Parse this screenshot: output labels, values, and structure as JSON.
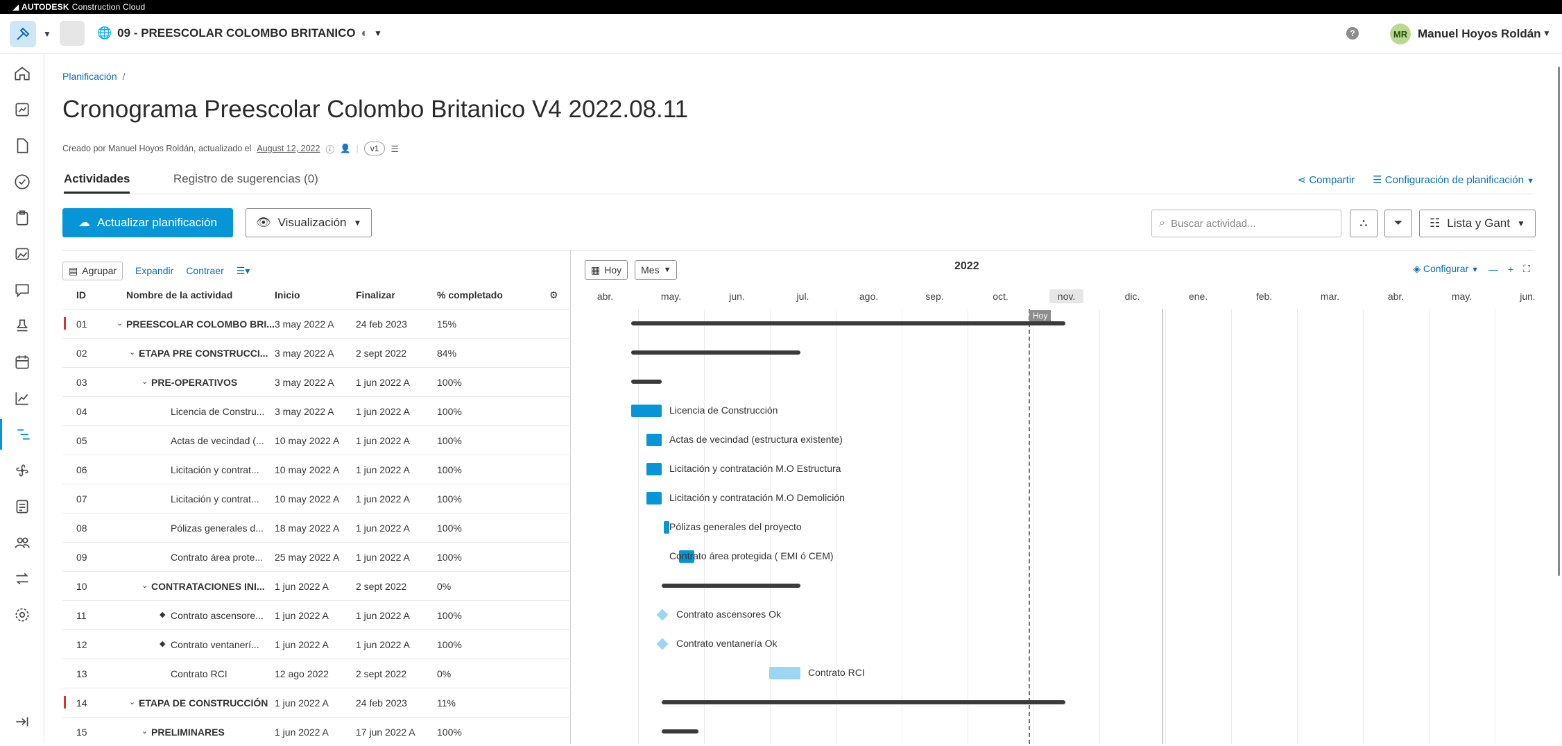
{
  "app": {
    "brand": "AUTODESK",
    "brand_sub": "Construction Cloud",
    "project": "09 - PREESCOLAR COLOMBO BRITANICO",
    "user_initials": "MR",
    "user_name": "Manuel Hoyos Roldán"
  },
  "sidebar": {
    "items": [
      "home-icon",
      "dashboard-icon",
      "document-icon",
      "checklist-icon",
      "clipboard-icon",
      "photo-icon",
      "chat-icon",
      "stamp-icon",
      "calendar-icon",
      "chart-icon",
      "schedule-icon",
      "fan-icon",
      "forms-icon",
      "people-icon",
      "transfer-icon",
      "gear-icon",
      "collapse-icon"
    ],
    "active": "schedule-icon"
  },
  "page": {
    "breadcrumb": "Planificación",
    "title": "Cronograma Preescolar Colombo Britanico V4 2022.08.11",
    "meta_prefix": "Creado por Manuel Hoyos Roldán, actualizado el",
    "meta_date": "August 12, 2022",
    "version": "v1"
  },
  "tabs": {
    "activities": "Actividades",
    "suggestions": "Registro de sugerencias (0)",
    "share": "Compartir",
    "config": "Configuración de planificación"
  },
  "toolbar": {
    "update": "Actualizar planificación",
    "view": "Visualización",
    "search_placeholder": "Buscar actividad...",
    "list_gantt": "Lista y Gant"
  },
  "list": {
    "group": "Agrupar",
    "expand": "Expandir",
    "collapse": "Contraer",
    "headers": {
      "id": "ID",
      "name": "Nombre de la actividad",
      "start": "Inicio",
      "finish": "Finalizar",
      "pct": "% completado"
    },
    "rows": [
      {
        "id": "01",
        "name": "PREESCOLAR COLOMBO BRI...",
        "start": "3 may 2022 A",
        "finish": "24 feb 2023",
        "pct": "15%"
      },
      {
        "id": "02",
        "name": "ETAPA PRE CONSTRUCCI...",
        "start": "3 may 2022 A",
        "finish": "2 sept 2022",
        "pct": "84%"
      },
      {
        "id": "03",
        "name": "PRE-OPERATIVOS",
        "start": "3 may 2022 A",
        "finish": "1 jun 2022 A",
        "pct": "100%"
      },
      {
        "id": "04",
        "name": "Licencia de Constru...",
        "start": "3 may 2022 A",
        "finish": "1 jun 2022 A",
        "pct": "100%"
      },
      {
        "id": "05",
        "name": "Actas de vecindad (...",
        "start": "10 may 2022 A",
        "finish": "1 jun 2022 A",
        "pct": "100%"
      },
      {
        "id": "06",
        "name": "Licitación y contrat...",
        "start": "10 may 2022 A",
        "finish": "1 jun 2022 A",
        "pct": "100%"
      },
      {
        "id": "07",
        "name": "Licitación y contrat...",
        "start": "10 may 2022 A",
        "finish": "1 jun 2022 A",
        "pct": "100%"
      },
      {
        "id": "08",
        "name": "Pólizas generales d...",
        "start": "18 may 2022 A",
        "finish": "1 jun 2022 A",
        "pct": "100%"
      },
      {
        "id": "09",
        "name": "Contrato área prote...",
        "start": "25 may 2022 A",
        "finish": "1 jun 2022 A",
        "pct": "100%"
      },
      {
        "id": "10",
        "name": "CONTRATACIONES INI...",
        "start": "1 jun 2022 A",
        "finish": "2 sept 2022",
        "pct": "0%"
      },
      {
        "id": "11",
        "name": "Contrato ascensore...",
        "start": "1 jun 2022 A",
        "finish": "1 jun 2022 A",
        "pct": "100%"
      },
      {
        "id": "12",
        "name": "Contrato ventanerí...",
        "start": "1 jun 2022 A",
        "finish": "1 jun 2022 A",
        "pct": "100%"
      },
      {
        "id": "13",
        "name": "Contrato RCI",
        "start": "12 ago 2022",
        "finish": "2 sept 2022",
        "pct": "0%"
      },
      {
        "id": "14",
        "name": "ETAPA DE CONSTRUCCIÓN",
        "start": "1 jun 2022 A",
        "finish": "24 feb 2023",
        "pct": "11%"
      },
      {
        "id": "15",
        "name": "PRELIMINARES",
        "start": "1 jun 2022 A",
        "finish": "17 jun 2022 A",
        "pct": "100%"
      }
    ]
  },
  "gantt": {
    "today": "Hoy",
    "scale": "Mes",
    "year": "2022",
    "configure": "Configurar",
    "months": [
      "abr.",
      "may.",
      "jun.",
      "jul.",
      "ago.",
      "sep.",
      "oct.",
      "nov.",
      "dic.",
      "ene.",
      "feb.",
      "mar.",
      "abr.",
      "may.",
      "jun."
    ],
    "today_label": "Hoy",
    "labels": {
      "r04": "Licencia de Construcción",
      "r05": "Actas de vecindad (estructura existente)",
      "r06": "Licitación y contratación M.O Estructura",
      "r07": "Licitación y contratación M.O Demolición",
      "r08": "Pólizas generales del proyecto",
      "r09": "Contrato área protegida ( EMI ó CEM)",
      "r11": "Contrato ascensores Ok",
      "r12": "Contrato ventanería Ok",
      "r13": "Contrato RCI"
    }
  }
}
